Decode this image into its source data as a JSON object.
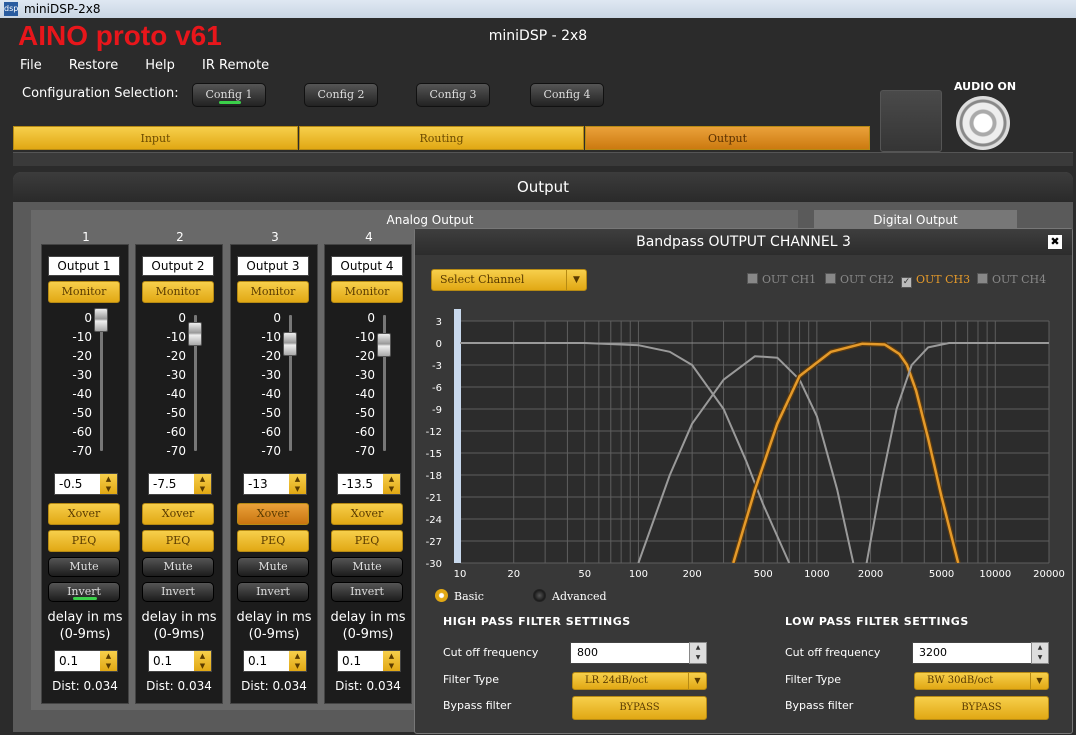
{
  "os_window": {
    "title": "miniDSP-2x8",
    "icon": "dsp"
  },
  "header": {
    "brand": "AINO proto v61",
    "title": "miniDSP - 2x8"
  },
  "menu": [
    "File",
    "Restore",
    "Help",
    "IR Remote"
  ],
  "config": {
    "label": "Configuration Selection:",
    "buttons": [
      "Config 1",
      "Config 2",
      "Config 3",
      "Config 4"
    ],
    "active_index": 0
  },
  "audio": {
    "label": "AUDIO ON",
    "icon": "speaker-icon"
  },
  "tabs": [
    {
      "label": "Input",
      "active": false
    },
    {
      "label": "Routing",
      "active": false
    },
    {
      "label": "Output",
      "active": true
    }
  ],
  "output_panel": {
    "title": "Output",
    "analog_label": "Analog Output",
    "digital_label": "Digital Output"
  },
  "channels": [
    {
      "number": "1",
      "name": "Output 1",
      "monitor": "Monitor",
      "gain": "-0.5",
      "level_db": -0.5,
      "xover": "Xover",
      "xover_active": false,
      "peq": "PEQ",
      "mute": "Mute",
      "invert": "Invert",
      "invert_on": true,
      "delay_label": "delay in ms",
      "delay_range": "(0-9ms)",
      "delay": "0.1",
      "dist": "Dist: 0.034"
    },
    {
      "number": "2",
      "name": "Output 2",
      "monitor": "Monitor",
      "gain": "-7.5",
      "level_db": -7.5,
      "xover": "Xover",
      "xover_active": false,
      "peq": "PEQ",
      "mute": "Mute",
      "invert": "Invert",
      "invert_on": false,
      "delay_label": "delay in ms",
      "delay_range": "(0-9ms)",
      "delay": "0.1",
      "dist": "Dist: 0.034"
    },
    {
      "number": "3",
      "name": "Output 3",
      "monitor": "Monitor",
      "gain": "-13",
      "level_db": -13,
      "xover": "Xover",
      "xover_active": true,
      "peq": "PEQ",
      "mute": "Mute",
      "invert": "Invert",
      "invert_on": false,
      "delay_label": "delay in ms",
      "delay_range": "(0-9ms)",
      "delay": "0.1",
      "dist": "Dist: 0.034"
    },
    {
      "number": "4",
      "name": "Output 4",
      "monitor": "Monitor",
      "gain": "-13.5",
      "level_db": -13.5,
      "xover": "Xover",
      "xover_active": false,
      "peq": "PEQ",
      "mute": "Mute",
      "invert": "Invert",
      "invert_on": false,
      "delay_label": "delay in ms",
      "delay_range": "(0-9ms)",
      "delay": "0.1",
      "dist": "Dist: 0.034"
    }
  ],
  "fader_scale": [
    "0",
    "-10",
    "-20",
    "-30",
    "-40",
    "-50",
    "-60",
    "-70"
  ],
  "bandpass": {
    "title": "Bandpass OUTPUT CHANNEL 3",
    "close": "✖",
    "select_channel": "Select Channel",
    "out_channels": [
      {
        "label": "OUT CH1",
        "checked": false
      },
      {
        "label": "OUT CH2",
        "checked": false
      },
      {
        "label": "OUT CH3",
        "checked": true
      },
      {
        "label": "OUT CH4",
        "checked": false
      }
    ],
    "mode": {
      "basic": "Basic",
      "advanced": "Advanced",
      "selected": "basic"
    },
    "high_pass": {
      "heading": "HIGH PASS FILTER SETTINGS",
      "cutoff_label": "Cut off frequency",
      "cutoff": "800",
      "type_label": "Filter Type",
      "type": "LR 24dB/oct",
      "bypass_label": "Bypass filter",
      "bypass_button": "BYPASS"
    },
    "low_pass": {
      "heading": "LOW PASS FILTER SETTINGS",
      "cutoff_label": "Cut off frequency",
      "cutoff": "3200",
      "type_label": "Filter Type",
      "type": "BW 30dB/oct",
      "bypass_label": "Bypass filter",
      "bypass_button": "BYPASS"
    }
  },
  "chart_data": {
    "type": "line",
    "title": "",
    "xlabel": "",
    "ylabel": "",
    "x_scale": "log",
    "xlim": [
      10,
      20000
    ],
    "ylim": [
      -30,
      3
    ],
    "x_ticks": [
      "10",
      "20",
      "50",
      "100",
      "200",
      "500",
      "1000",
      "2000",
      "5000",
      "10000",
      "20000"
    ],
    "y_ticks": [
      "3",
      "0",
      "-3",
      "-6",
      "-9",
      "-12",
      "-15",
      "-18",
      "-21",
      "-24",
      "-27",
      "-30"
    ],
    "grid": true,
    "series": [
      {
        "color": "#9a9a9a",
        "x": [
          10,
          50,
          100,
          150,
          200,
          300,
          400,
          500,
          700
        ],
        "y": [
          0,
          0,
          -0.3,
          -1.2,
          -3,
          -9,
          -16,
          -22,
          -30
        ]
      },
      {
        "color": "#9a9a9a",
        "x": [
          100,
          150,
          200,
          300,
          450,
          600,
          800,
          1000,
          1300,
          1600
        ],
        "y": [
          -30,
          -18,
          -11,
          -5,
          -1.8,
          -2,
          -5,
          -10,
          -20,
          -30
        ]
      },
      {
        "color": "#e59a2a",
        "x": [
          340,
          450,
          600,
          800,
          1200,
          1800,
          2400,
          2900,
          3200,
          3600,
          4200,
          5000,
          6200
        ],
        "y": [
          -30,
          -20,
          -11,
          -4.5,
          -1.2,
          -0.1,
          -0.2,
          -1.5,
          -3,
          -6.5,
          -13,
          -21,
          -30
        ]
      },
      {
        "color": "#9a9a9a",
        "x": [
          1900,
          2300,
          2800,
          3400,
          4200,
          5500,
          20000
        ],
        "y": [
          -30,
          -19,
          -9,
          -3,
          -0.6,
          0,
          0
        ]
      }
    ]
  }
}
